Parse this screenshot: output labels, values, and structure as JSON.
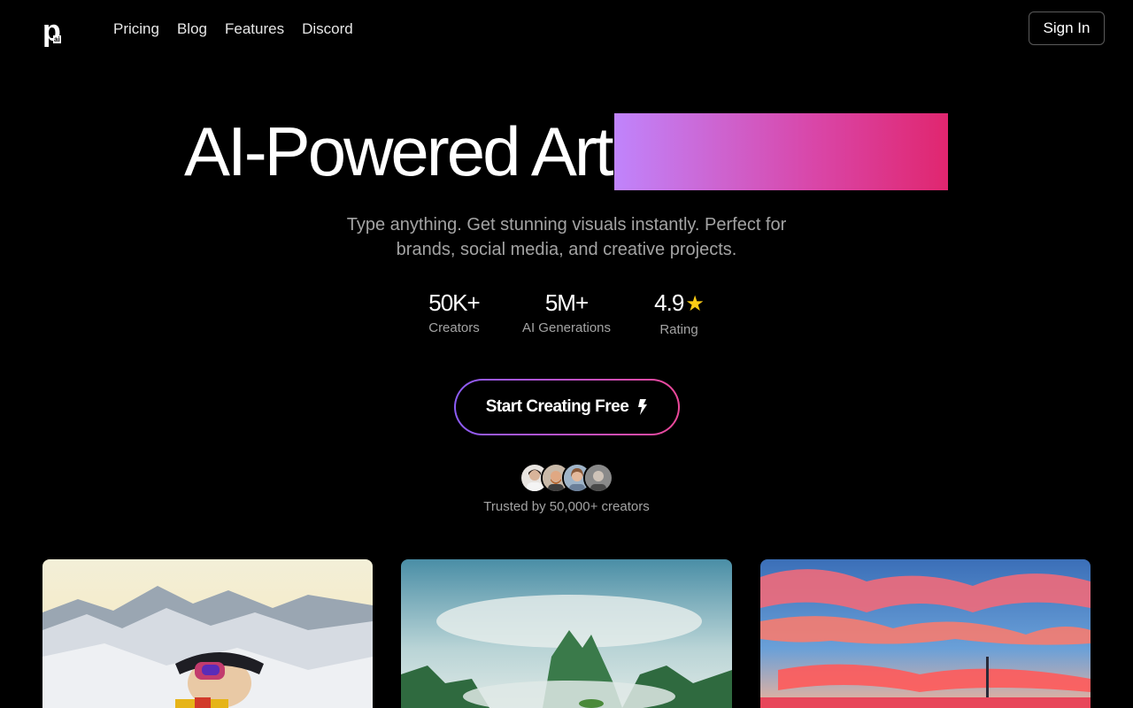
{
  "nav": {
    "logo_letter": "p",
    "logo_suffix": "ai",
    "links": [
      "Pricing",
      "Blog",
      "Features",
      "Discord"
    ],
    "signin_label": "Sign In"
  },
  "hero": {
    "title": "AI-Powered Art",
    "subtitle_line1": "Type anything. Get stunning visuals instantly. Perfect for",
    "subtitle_line2": "brands, social media, and creative projects.",
    "stats": [
      {
        "value": "50K+",
        "label": "Creators"
      },
      {
        "value": "5M+",
        "label": "AI Generations"
      },
      {
        "value": "4.9",
        "label": "Rating",
        "icon": "star-icon"
      }
    ],
    "cta_label": "Start Creating Free",
    "cta_icon": "bolt-icon",
    "trusted_text": "Trusted by 50,000+ creators"
  },
  "colors": {
    "background": "#000000",
    "gradient_start": "#c084fc",
    "gradient_end": "#e0266f",
    "muted_text": "#a3a3a3",
    "star": "#facc15"
  },
  "gallery": {
    "items": [
      "skier-with-goggles-on-snowy-mountains",
      "misty-green-karst-mountains",
      "pink-sunset-clouds-over-sea"
    ]
  }
}
